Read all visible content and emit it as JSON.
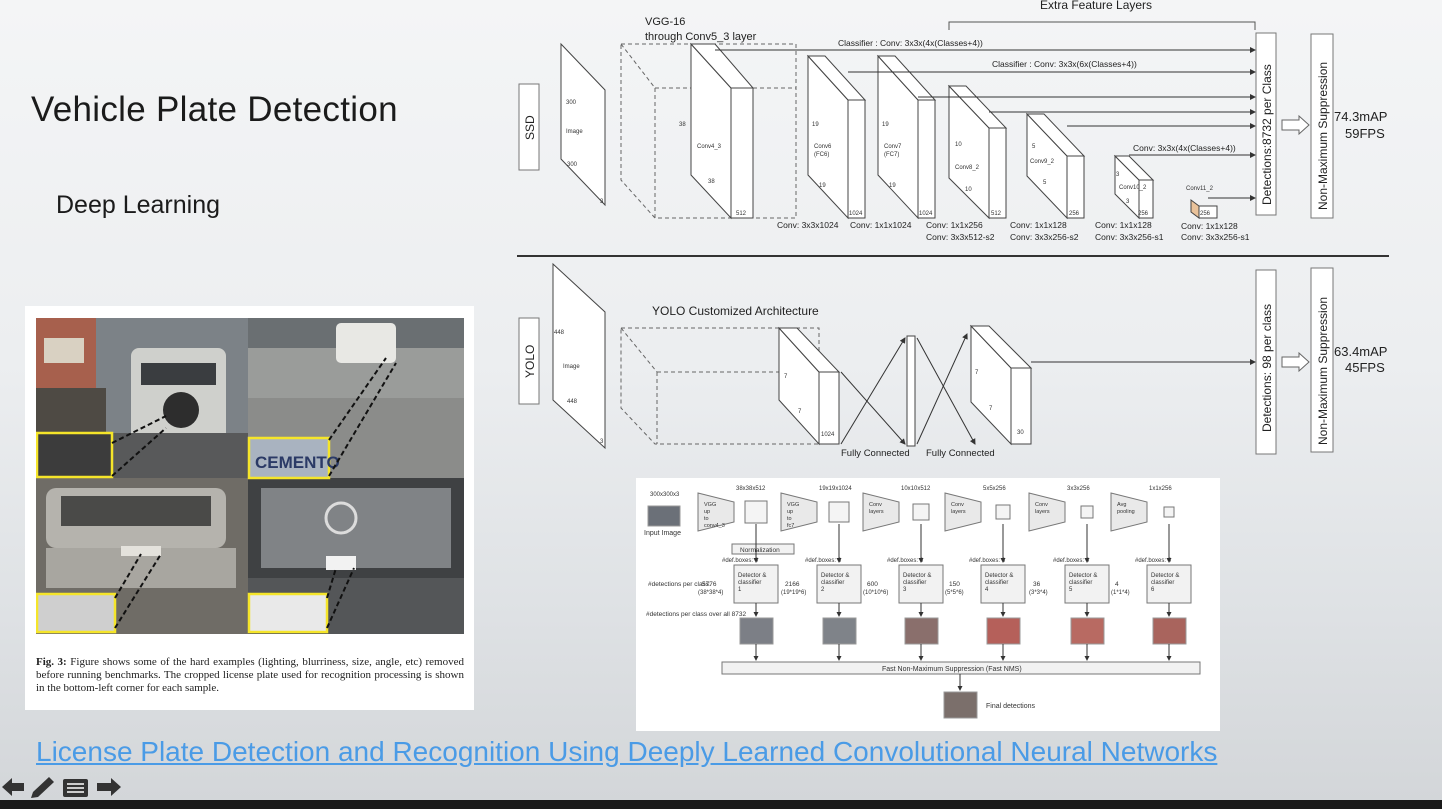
{
  "slide": {
    "title": "Vehicle Plate Detection",
    "subtitle": "Deep Learning",
    "link_text": "License Plate Detection and Recognition Using Deeply Learned Convolutional Neural Networks"
  },
  "figure": {
    "caption_label": "Fig. 3:",
    "caption_text": "Figure shows some of the hard examples (lighting, blurriness, size, angle, etc) removed before running benchmarks. The cropped license plate used for recognition processing is shown in the bottom-left corner for each sample.",
    "plate_text": "CEMENTO"
  },
  "arch": {
    "extra_feature_layers": "Extra Feature Layers",
    "vgg_line1": "VGG-16",
    "vgg_line2": "through Conv5_3 layer",
    "classifier1": "Classifier : Conv: 3x3x(4x(Classes+4))",
    "classifier2": "Classifier : Conv: 3x3x(6x(Classes+4))",
    "classifier3": "Conv: 3x3x(4x(Classes+4))",
    "ssd_label": "SSD",
    "yolo_label": "YOLO",
    "image": "Image",
    "n300": "300",
    "n448": "448",
    "n3": "3",
    "conv4_3": "Conv4_3",
    "conv6": "Conv6",
    "fc6": "(FC6)",
    "conv7": "Conv7",
    "fc7": "(FC7)",
    "conv8_2": "Conv8_2",
    "conv9_2": "Conv9_2",
    "conv10_2": "Conv10_2",
    "conv11_2": "Conv11_2",
    "n38": "38",
    "n19": "19",
    "n10": "10",
    "n5": "5",
    "n7": "7",
    "n512": "512",
    "n1024": "1024",
    "n256": "256",
    "n30": "30",
    "conv_a": "Conv: 3x3x1024",
    "conv_b": "Conv: 1x1x1024",
    "conv_c1": "Conv: 1x1x256",
    "conv_c2": "Conv: 3x3x512-s2",
    "conv_d1": "Conv: 1x1x128",
    "conv_d2": "Conv: 3x3x256-s2",
    "conv_e1": "Conv: 1x1x128",
    "conv_e2": "Conv: 3x3x256-s1",
    "conv_f1": "Conv: 1x1x128",
    "conv_f2": "Conv: 3x3x256-s1",
    "ssd_detections": "Detections:8732 per Class",
    "ssd_nms": "Non-Maximum Suppression",
    "ssd_map": "74.3mAP",
    "ssd_fps": "59FPS",
    "yolo_title": "YOLO Customized Architecture",
    "fully_connected": "Fully Connected",
    "yolo_detections": "Detections: 98 per class",
    "yolo_nms": "Non-Maximum Suppression",
    "yolo_map": "63.4mAP",
    "yolo_fps": "45FPS"
  },
  "ssd_diagram": {
    "input_size": "300x300x3",
    "input_image": "Input Image",
    "vgg_conv4": "VGG up to conv4_3",
    "vgg_fc7": "VGG up to fc7",
    "conv_layers": "Conv layers",
    "avg_pooling": "Avg pooling",
    "normalization": "Normalization",
    "detections_per_class": "#detections per class:",
    "detections_over_all": "#detections per class over all 8732",
    "fast_nms": "Fast Non-Maximum Suppression (Fast NMS)",
    "final_detections": "Final detections",
    "stages": [
      {
        "size": "38x38x512",
        "boxes": "#def.boxes: 4",
        "count": "5776",
        "formula": "(38*38*4)",
        "detector": "Detector & classifier 1"
      },
      {
        "size": "19x19x1024",
        "boxes": "#def.boxes: 6",
        "count": "2166",
        "formula": "(19*19*6)",
        "detector": "Detector & classifier 2"
      },
      {
        "size": "10x10x512",
        "boxes": "#def.boxes: 6",
        "count": "600",
        "formula": "(10*10*6)",
        "detector": "Detector & classifier 3"
      },
      {
        "size": "5x5x256",
        "boxes": "#def.boxes: 6",
        "count": "150",
        "formula": "(5*5*6)",
        "detector": "Detector & classifier 4"
      },
      {
        "size": "3x3x256",
        "boxes": "#def.boxes: 4",
        "count": "36",
        "formula": "(3*3*4)",
        "detector": "Detector & classifier 5"
      },
      {
        "size": "1x1x256",
        "boxes": "#def.boxes: 4",
        "count": "4",
        "formula": "(1*1*4)",
        "detector": "Detector & classifier 6"
      }
    ]
  },
  "nav": {
    "icons": [
      "arrow-left-icon",
      "pencil-icon",
      "menu-icon",
      "arrow-right-icon"
    ]
  }
}
